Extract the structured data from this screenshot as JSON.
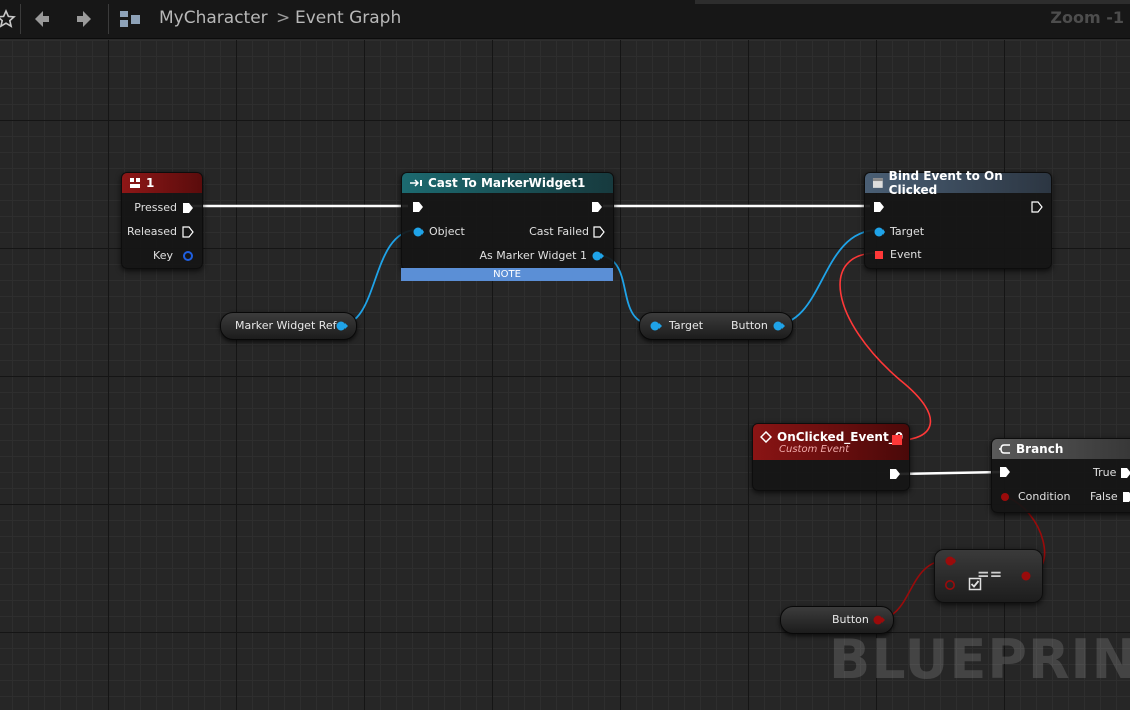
{
  "toolbar": {
    "breadcrumb_root": "MyCharacter",
    "breadcrumb_separator": ">",
    "breadcrumb_current": "Event Graph",
    "zoom_label": "Zoom -1"
  },
  "nodes": {
    "key_event": {
      "title": "1",
      "pins": {
        "pressed": "Pressed",
        "released": "Released",
        "key": "Key"
      }
    },
    "cast": {
      "title": "Cast To MarkerWidget1",
      "pins": {
        "object": "Object",
        "cast_failed": "Cast Failed",
        "as_marker": "As Marker Widget 1"
      },
      "note": "NOTE"
    },
    "bind_event": {
      "title": "Bind Event to On Clicked",
      "pins": {
        "target": "Target",
        "event": "Event"
      }
    },
    "get_button": {
      "pins": {
        "target": "Target",
        "button": "Button"
      }
    },
    "marker_ref": {
      "label": "Marker Widget Ref"
    },
    "custom_event": {
      "title": "OnClicked_Event_0",
      "subtitle": "Custom Event"
    },
    "branch": {
      "title": "Branch",
      "pins": {
        "true": "True",
        "condition": "Condition",
        "false": "False"
      }
    },
    "equals": {
      "symbol": "=="
    },
    "button_var": {
      "label": "Button"
    }
  },
  "watermark": "BLUEPRINT",
  "colors": {
    "exec": "#ffffff",
    "object_pin": "#1fa3e8",
    "bool_pin": "#9a0b0b",
    "delegate_pin": "#ff3838",
    "input_header": "#8e1717",
    "cast_header": "#1c6a70",
    "function_header": "#4a5f75",
    "event_header": "#7a1212",
    "branch_header": "#555555"
  }
}
